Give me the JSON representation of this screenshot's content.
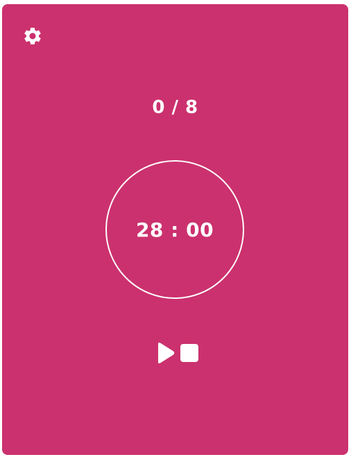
{
  "colors": {
    "background": "#cb316e",
    "foreground": "#ffffff"
  },
  "settings": {
    "icon": "gear-icon"
  },
  "session_counter": {
    "text": "0 / 8"
  },
  "timer": {
    "display": "28 : 00"
  },
  "controls": {
    "play_icon": "play-icon",
    "stop_icon": "stop-icon"
  }
}
